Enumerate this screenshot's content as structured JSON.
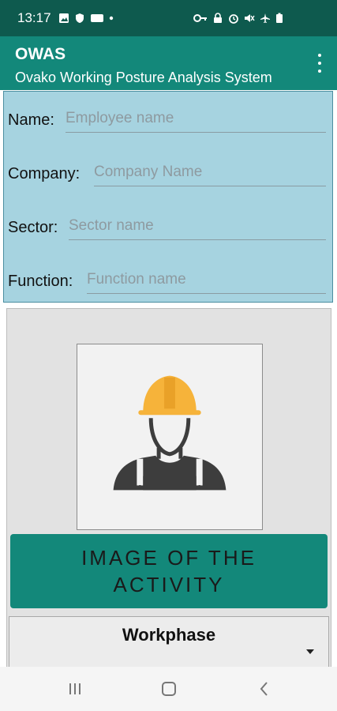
{
  "status_bar": {
    "time": "13:17",
    "left_icons": [
      "gallery-icon",
      "shield-icon",
      "dnd-badge-icon",
      "dot-icon"
    ],
    "right_icons": [
      "key-icon",
      "lock-icon",
      "alarm-icon",
      "mute-icon",
      "airplane-icon",
      "battery-icon"
    ]
  },
  "app_bar": {
    "title": "OWAS",
    "subtitle": "Ovako Working Posture Analysis System",
    "menu_icon": "more-vert-icon"
  },
  "form": {
    "name_label": "Name:",
    "name_placeholder": "Employee name",
    "name_value": "",
    "company_label": "Company:",
    "company_placeholder": "Company Name",
    "company_value": "",
    "sector_label": "Sector:",
    "sector_placeholder": "Sector name",
    "sector_value": "",
    "function_label": "Function:",
    "function_placeholder": "Function name",
    "function_value": ""
  },
  "activity": {
    "image_icon": "worker-hardhat-icon",
    "button_line1": "IMAGE OF THE",
    "button_line2": "ACTIVITY"
  },
  "workphase": {
    "title": "Workphase",
    "dropdown_icon": "dropdown-arrow-icon"
  },
  "nav_bar": {
    "icons": [
      "recents-icon",
      "home-icon",
      "back-icon"
    ]
  },
  "colors": {
    "status_bar": "#0e5a4e",
    "app_bar": "#13887a",
    "form_bg": "#a6d3e0",
    "panel_bg": "#e2e2e2",
    "button_bg": "#13887a",
    "helmet": "#f6b33a"
  }
}
